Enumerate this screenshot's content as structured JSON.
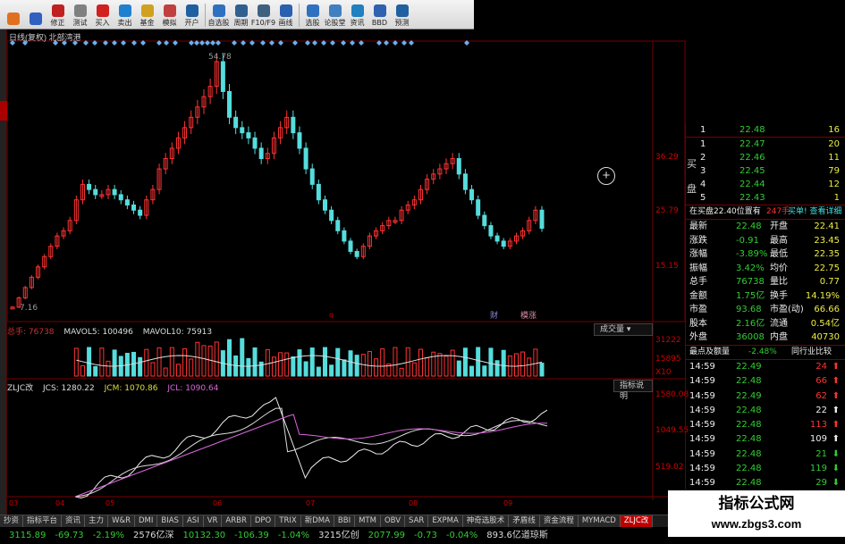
{
  "toolbar": {
    "buttons": [
      {
        "label": "",
        "icon": "orange-square-icon",
        "color": "#e07020"
      },
      {
        "label": "",
        "icon": "arrow-icon",
        "color": "#3060c0"
      },
      {
        "label": "修正",
        "icon": "wrench-icon",
        "color": "#c02020"
      },
      {
        "label": "测试",
        "icon": "test-icon",
        "color": "#808080"
      },
      {
        "label": "买入",
        "icon": "buy-icon",
        "color": "#d02020"
      },
      {
        "label": "卖出",
        "icon": "sell-icon",
        "color": "#2080d0"
      },
      {
        "label": "基金",
        "icon": "fund-icon",
        "color": "#d0a020"
      },
      {
        "label": "模拟",
        "icon": "simulate-icon",
        "color": "#c04040"
      },
      {
        "label": "开户",
        "icon": "account-icon",
        "color": "#2060a0"
      },
      {
        "label": "自选股",
        "icon": "watchlist-icon",
        "color": "#3070c0"
      },
      {
        "label": "周期",
        "icon": "period-icon",
        "color": "#306090"
      },
      {
        "label": "F10/F9",
        "icon": "f10-icon",
        "color": "#406080"
      },
      {
        "label": "画线",
        "icon": "draw-line-icon",
        "color": "#2a60b0"
      },
      {
        "label": "选股",
        "icon": "stock-picker-icon",
        "color": "#3070c0"
      },
      {
        "label": "论股堂",
        "icon": "forum-icon",
        "color": "#4080c0"
      },
      {
        "label": "资讯",
        "icon": "news-icon",
        "color": "#2080c0"
      },
      {
        "label": "BBD",
        "icon": "bbd-icon",
        "color": "#3060b0"
      },
      {
        "label": "预测",
        "icon": "forecast-icon",
        "color": "#2060a0"
      }
    ],
    "extra_labels": [
      "财富通",
      "研报"
    ]
  },
  "chart": {
    "title": "日线(复权) 北部湾港",
    "price_high_label": "54.78",
    "price_low_label": "7.16",
    "y_labels": [
      "36.29",
      "25.79",
      "15.15"
    ],
    "markers": [
      "q",
      "财",
      "模涨"
    ],
    "volume_y_labels": [
      "31222",
      "15895",
      "X10"
    ],
    "indicator_y_labels": [
      "1580.08",
      "1049.55",
      "519.02"
    ],
    "x_labels": [
      "03",
      "04",
      "05",
      "06",
      "07",
      "08",
      "09"
    ]
  },
  "volume_legend": {
    "total": "总手: 76738",
    "ma5": "MAVOL5: 100496",
    "ma10": "MAVOL10: 75913",
    "button": "成交量"
  },
  "indicator_legend": {
    "name": "ZLJC改",
    "jcs": "JCS: 1280.22",
    "jcm": "JCM: 1070.86",
    "jcl": "JCL: 1090.64",
    "button": "指标说明"
  },
  "quote_panel": {
    "sell_label": "卖",
    "buy_label": "买盘",
    "bids": [
      {
        "n": "1",
        "price": "22.48",
        "vol": "16"
      },
      {
        "n": "1",
        "price": "22.47",
        "vol": "20"
      },
      {
        "n": "2",
        "price": "22.46",
        "vol": "11"
      },
      {
        "n": "3",
        "price": "22.45",
        "vol": "79"
      },
      {
        "n": "4",
        "price": "22.44",
        "vol": "12"
      },
      {
        "n": "5",
        "price": "22.43",
        "vol": "1"
      }
    ],
    "position_text": "在买盘22.40位置有",
    "position_vol": "247手",
    "detail_link": "买单! 查看详细",
    "stats": [
      {
        "l1": "最新",
        "v1": "22.48",
        "l2": "开盘",
        "v2": "22.41"
      },
      {
        "l1": "涨跌",
        "v1": "-0.91",
        "l2": "最高",
        "v2": "23.45"
      },
      {
        "l1": "涨幅",
        "v1": "-3.89%",
        "l2": "最低",
        "v2": "22.35"
      },
      {
        "l1": "振幅",
        "v1": "3.42%",
        "l2": "均价",
        "v2": "22.75"
      },
      {
        "l1": "总手",
        "v1": "76738",
        "l2": "量比",
        "v2": "0.77"
      },
      {
        "l1": "金额",
        "v1": "1.75亿",
        "l2": "换手",
        "v2": "14.19%"
      },
      {
        "l1": "市盈",
        "v1": "93.68",
        "l2": "市盈(动)",
        "v2": "66.66"
      },
      {
        "l1": "股本",
        "v1": "2.16亿",
        "l2": "流通",
        "v2": "0.54亿"
      },
      {
        "l1": "外盘",
        "v1": "36008",
        "l2": "内盘",
        "v2": "40730"
      }
    ],
    "ticks_header": "最点及额量",
    "ticks_change": "-2.48%",
    "ticks_compare": "同行业比较",
    "ticks": [
      {
        "t": "14:59",
        "p": "22.49",
        "v": "24",
        "dir": "up"
      },
      {
        "t": "14:59",
        "p": "22.48",
        "v": "66",
        "dir": "up"
      },
      {
        "t": "14:59",
        "p": "22.49",
        "v": "62",
        "dir": "up"
      },
      {
        "t": "14:59",
        "p": "22.48",
        "v": "22",
        "dir": "upw"
      },
      {
        "t": "14:59",
        "p": "22.48",
        "v": "113",
        "dir": "up"
      },
      {
        "t": "14:59",
        "p": "22.48",
        "v": "109",
        "dir": "upw"
      },
      {
        "t": "14:59",
        "p": "22.48",
        "v": "21",
        "dir": "down"
      },
      {
        "t": "14:59",
        "p": "22.48",
        "v": "119",
        "dir": "down"
      },
      {
        "t": "14:59",
        "p": "22.48",
        "v": "29",
        "dir": "down"
      }
    ]
  },
  "bottom_tabs": [
    "抄资",
    "指标平台",
    "资讯",
    "主力",
    "W&R",
    "DMI",
    "BIAS",
    "ASI",
    "VR",
    "ARBR",
    "DPO",
    "TRIX",
    "新DMA",
    "BBI",
    "MTM",
    "OBV",
    "SAR",
    "EXPMA",
    "神奇选股术",
    "矛盾线",
    "资金流程",
    "MYMACD",
    "ZLJC改"
  ],
  "active_tab": "ZLJC改",
  "statusbar": [
    {
      "text": "3115.89",
      "color": "#3c3"
    },
    {
      "text": "-69.73",
      "color": "#3c3"
    },
    {
      "text": "-2.19%",
      "color": "#3c3"
    },
    {
      "text": "2576亿深",
      "color": "#ddd"
    },
    {
      "text": "10132.30",
      "color": "#3c3"
    },
    {
      "text": "-106.39",
      "color": "#3c3"
    },
    {
      "text": "-1.04%",
      "color": "#3c3"
    },
    {
      "text": "3215亿创",
      "color": "#ddd"
    },
    {
      "text": "2077.99",
      "color": "#3c3"
    },
    {
      "text": "-0.73",
      "color": "#3c3"
    },
    {
      "text": "-0.04%",
      "color": "#3c3"
    },
    {
      "text": "893.6亿道琼斯",
      "color": "#ddd"
    }
  ],
  "watermark": {
    "line1": "指标公式网",
    "line2": "www.zbgs3.com"
  },
  "chart_data": {
    "type": "candlestick",
    "title": "日线(复权) 北部湾港",
    "closes": [
      7.2,
      9,
      11,
      13,
      15,
      17,
      19,
      21,
      22,
      24,
      28,
      31,
      30,
      29,
      29,
      30,
      29,
      28,
      27,
      26,
      25,
      28,
      30,
      34,
      36,
      38,
      40,
      42,
      44,
      46,
      48,
      50,
      54.78,
      49,
      44,
      42,
      41,
      40,
      38,
      36,
      37,
      40,
      42,
      44,
      41,
      38,
      34,
      31,
      28,
      26,
      24,
      22,
      20,
      18,
      17,
      19,
      21,
      22,
      23,
      24,
      24,
      26,
      27,
      28,
      30,
      32,
      33,
      34,
      35,
      36,
      33,
      30,
      28,
      25,
      23,
      21,
      20,
      19,
      20,
      21,
      22,
      24,
      26,
      22.48
    ],
    "ylim": [
      7,
      56
    ],
    "series": [
      {
        "name": "JCS",
        "last": 1280.22
      },
      {
        "name": "JCM",
        "last": 1070.86
      },
      {
        "name": "JCL",
        "last": 1090.64
      }
    ]
  }
}
